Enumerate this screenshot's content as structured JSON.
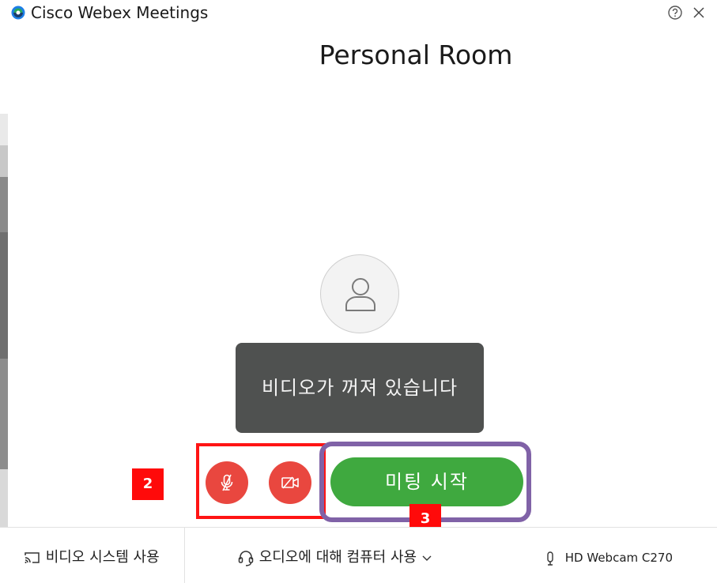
{
  "window": {
    "title": "Cisco Webex Meetings",
    "icons": [
      "webex-logo-icon",
      "help-icon",
      "close-icon"
    ]
  },
  "main": {
    "room_title": "Personal Room",
    "avatar_icon": "user-silhouette-icon",
    "video_status": "비디오가 꺼져 있습니다"
  },
  "controls": {
    "mute_icon": "microphone-muted-icon",
    "video_icon": "camera-off-icon",
    "start_button": "미팅 시작"
  },
  "annotations": {
    "badge_2": "2",
    "badge_3": "3"
  },
  "footer": {
    "video_system": "비디오 시스템 사용",
    "audio": "오디오에 대해 컴퓨터 사용",
    "camera": "HD Webcam C270"
  },
  "colors": {
    "mute_red": "#e9473f",
    "start_green": "#3fa93f",
    "annotation_red": "#ff1414",
    "annotation_purple": "#8062a7",
    "video_off_bg": "#4f5150"
  }
}
